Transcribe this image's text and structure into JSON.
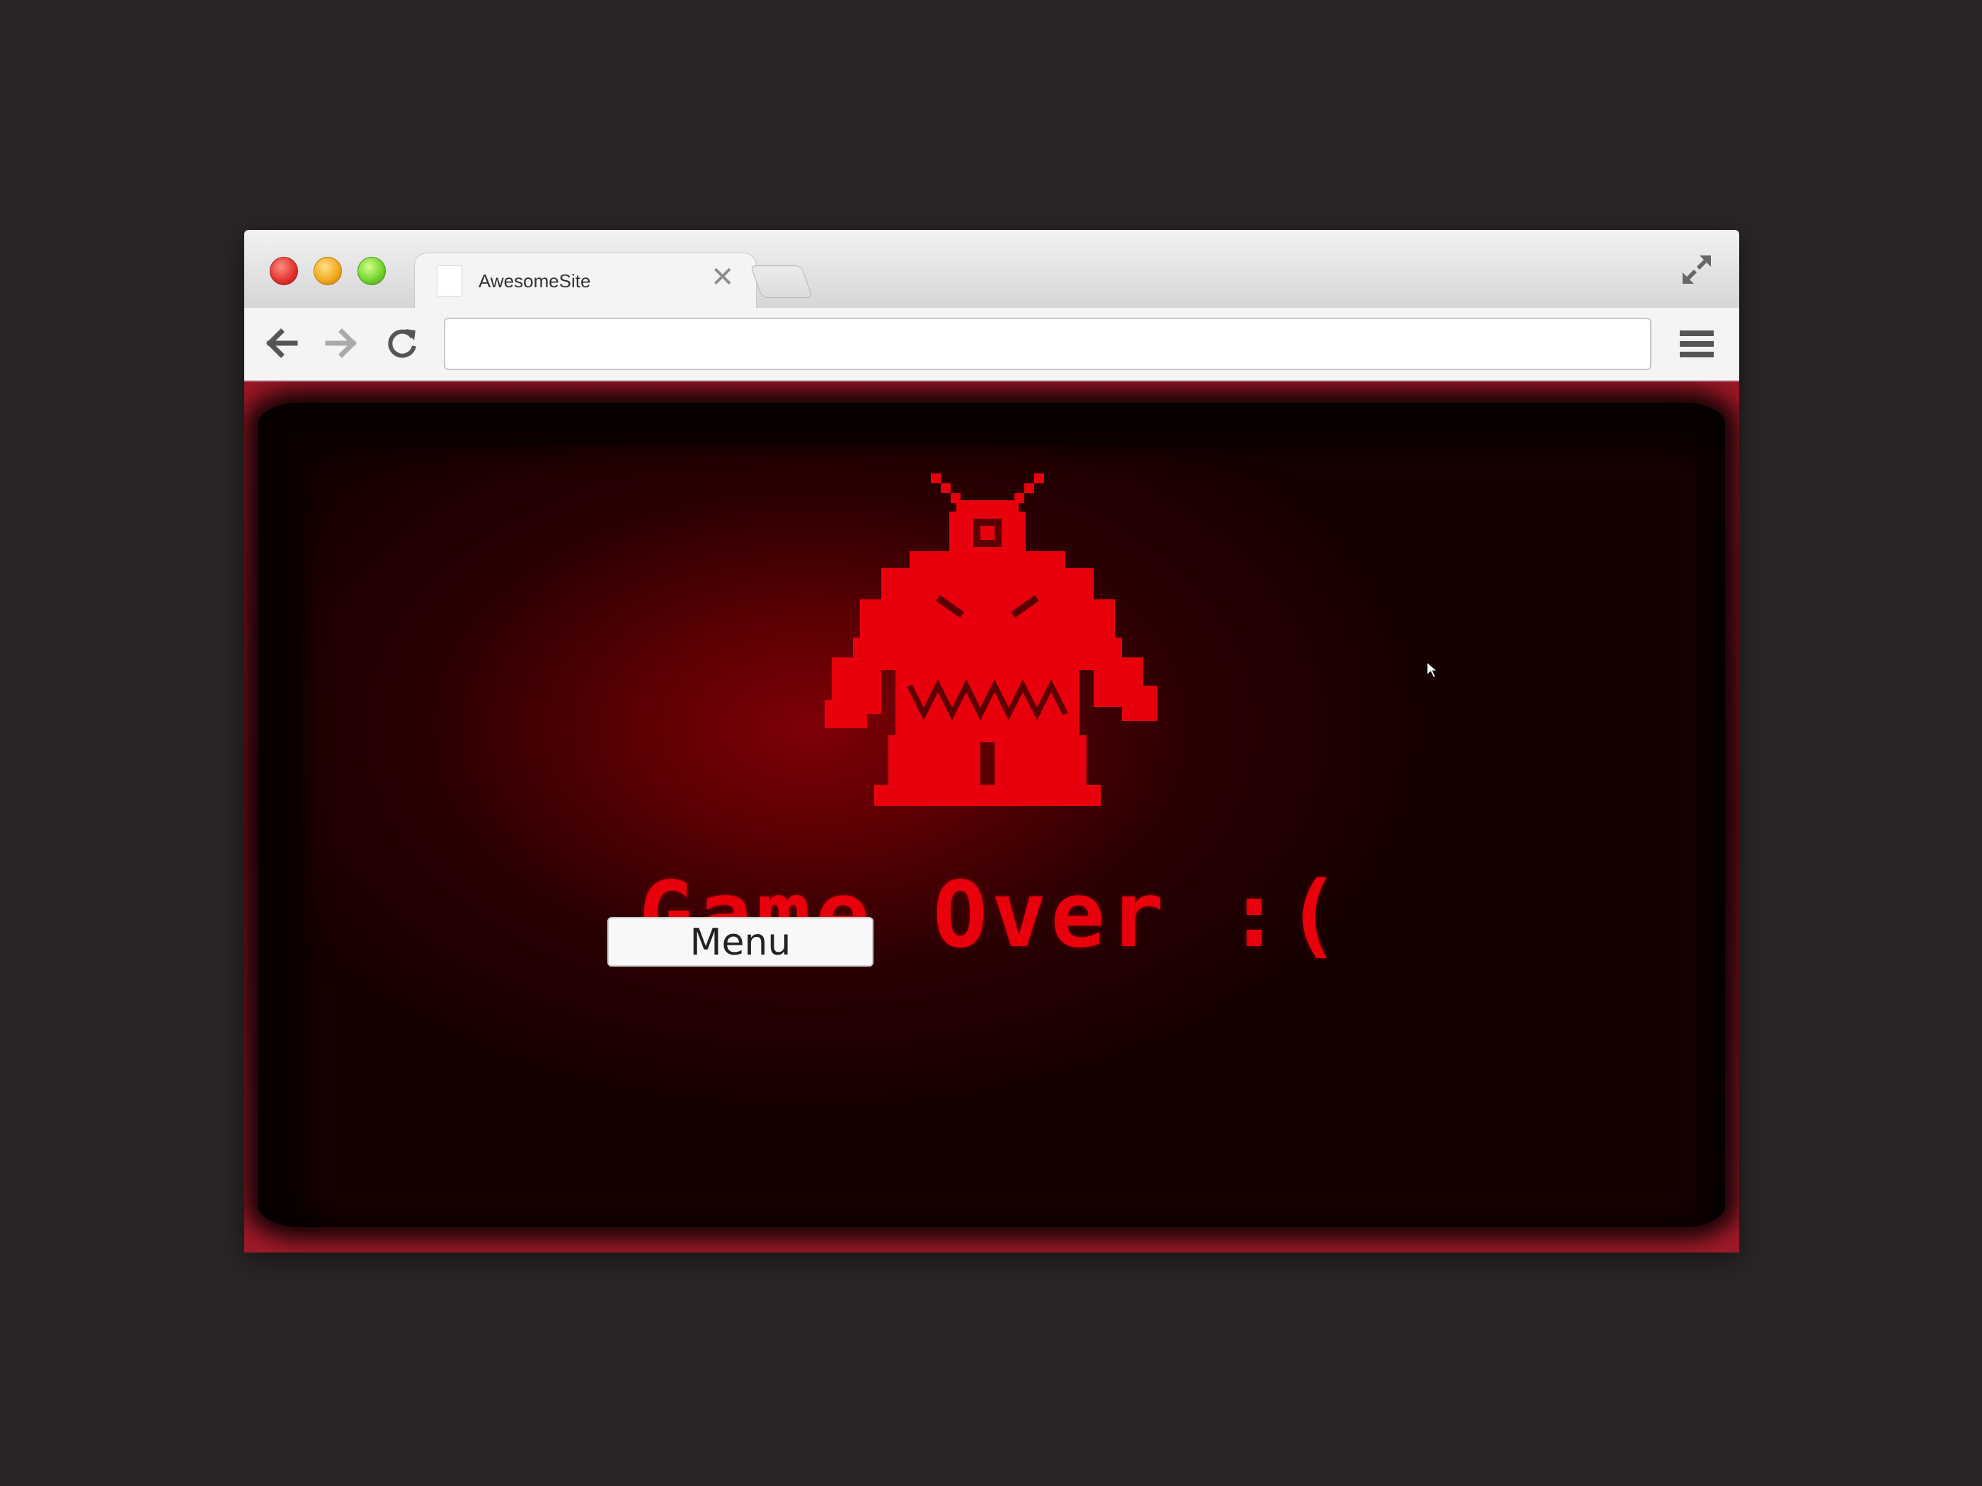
{
  "browser": {
    "tab": {
      "title": "AwesomeSite",
      "close_glyph": "✕"
    },
    "address_bar": {
      "value": "",
      "placeholder": ""
    },
    "icons": [
      "close-window",
      "minimize-window",
      "zoom-window",
      "fullscreen-icon",
      "back-arrow-icon",
      "forward-arrow-icon",
      "reload-icon",
      "hamburger-menu-icon"
    ]
  },
  "game": {
    "status_text": "Game Over :(",
    "menu_button_label": "Menu",
    "colors": {
      "accent": "#e8000c",
      "screen_dark": "#150000",
      "frame": "#9c1726"
    }
  }
}
